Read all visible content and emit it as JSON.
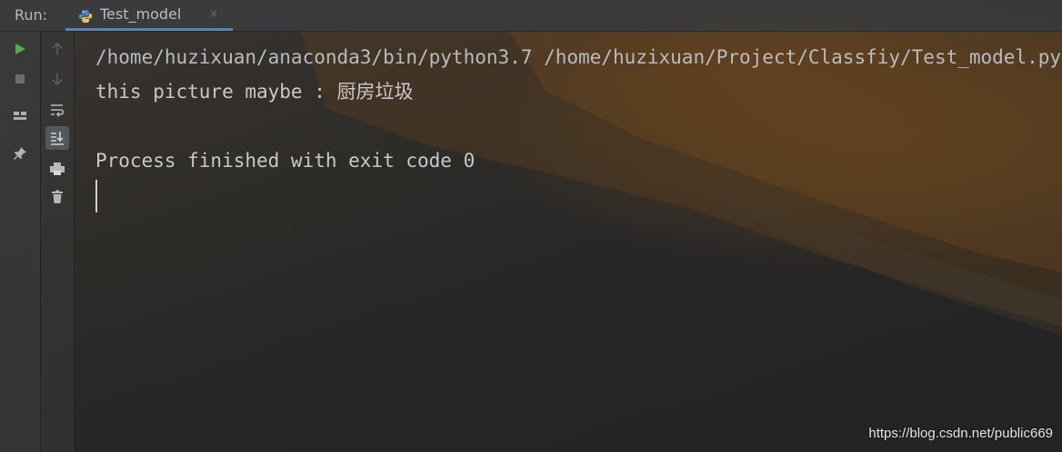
{
  "run_panel": {
    "label": "Run:",
    "tab": {
      "label": "Test_model",
      "close": "×",
      "icon": "python-icon"
    }
  },
  "toolbar": {
    "icons": [
      "run-icon",
      "up-arrow-icon",
      "stop-icon",
      "down-arrow-icon",
      "layout-icon",
      "soft-wrap-icon",
      "scroll-to-end-icon",
      "pin-icon",
      "print-icon",
      "trash-icon"
    ]
  },
  "console": {
    "lines": [
      "/home/huzixuan/anaconda3/bin/python3.7 /home/huzixuan/Project/Classfiy/Test_model.py",
      "this picture maybe : 厨房垃圾",
      "",
      "Process finished with exit code 0"
    ]
  },
  "watermark": "https://blog.csdn.net/public669",
  "colors": {
    "run_green": "#4eaf50",
    "tab_underline": "#4a88c7",
    "console_text": "#c8c8c8"
  }
}
